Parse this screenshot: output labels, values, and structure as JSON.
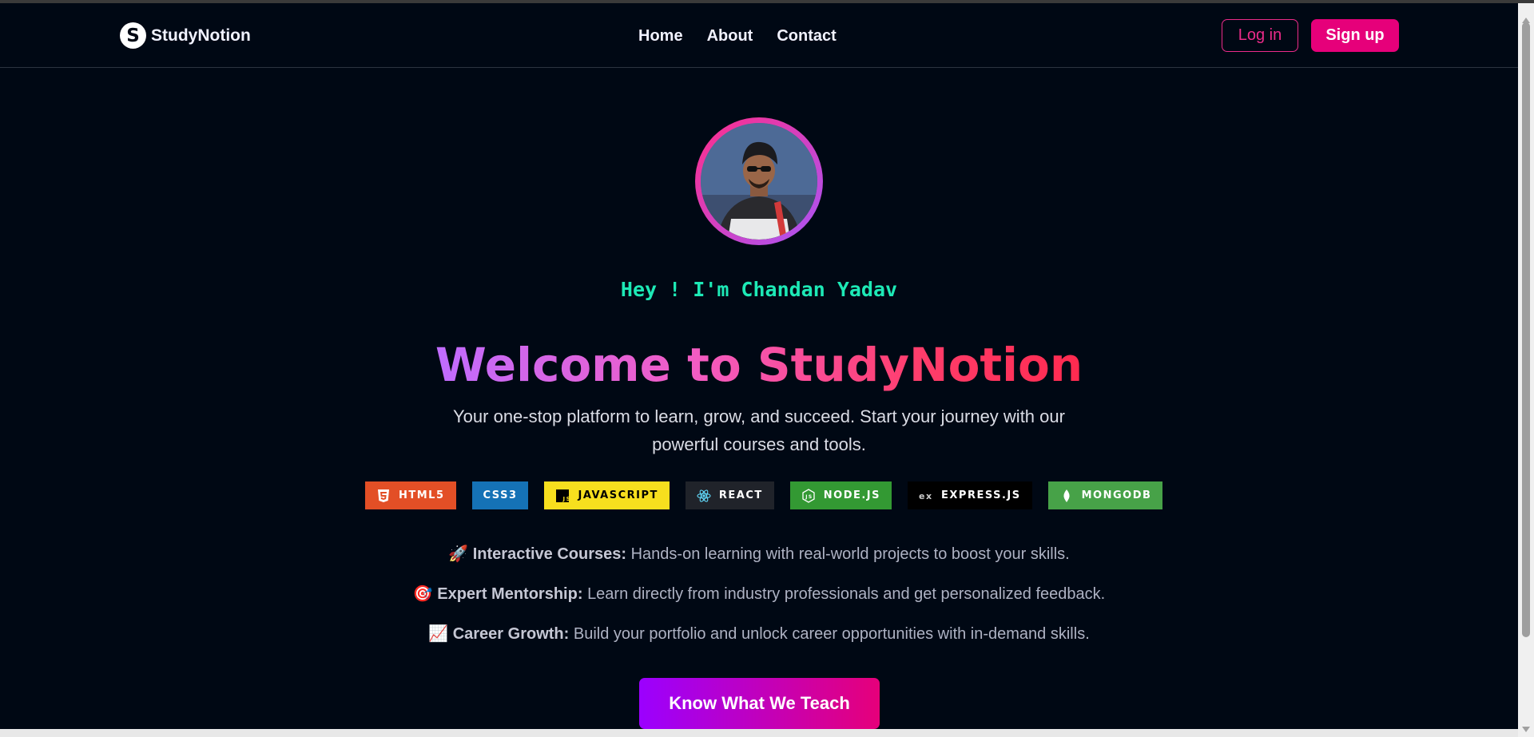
{
  "brand": {
    "logo_letter": "S",
    "name": "StudyNotion"
  },
  "nav": {
    "items": [
      "Home",
      "About",
      "Contact"
    ]
  },
  "auth": {
    "login_label": "Log in",
    "signup_label": "Sign up"
  },
  "hero": {
    "avatar": "profile-photo",
    "greeting": "Hey ! I'm Chandan Yadav",
    "headline": "Welcome to StudyNotion",
    "subtitle": "Your one-stop platform to learn, grow, and succeed. Start your journey with our powerful courses and tools."
  },
  "badges": [
    {
      "label": "HTML5",
      "color": "#e34f26",
      "icon": "html5-icon"
    },
    {
      "label": "CSS3",
      "color": "#1572b6",
      "icon": ""
    },
    {
      "label": "JAVASCRIPT",
      "color": "#f7df1e",
      "icon": "javascript-icon"
    },
    {
      "label": "REACT",
      "color": "#20232a",
      "icon": "react-icon"
    },
    {
      "label": "NODE.JS",
      "color": "#339933",
      "icon": "nodejs-icon"
    },
    {
      "label": "EXPRESS.JS",
      "color": "#000000",
      "icon": "express-icon"
    },
    {
      "label": "MONGODB",
      "color": "#47a248",
      "icon": "mongodb-icon"
    }
  ],
  "features": [
    {
      "emoji": "🚀",
      "title": "Interactive Courses:",
      "text": "Hands-on learning with real-world projects to boost your skills."
    },
    {
      "emoji": "🎯",
      "title": "Expert Mentorship:",
      "text": "Learn directly from industry professionals and get personalized feedback."
    },
    {
      "emoji": "📈",
      "title": "Career Growth:",
      "text": "Build your portfolio and unlock career opportunities with in-demand skills."
    }
  ],
  "cta": {
    "label": "Know What We Teach"
  },
  "colors": {
    "background": "#000814",
    "accent": "#e6007a",
    "greeting": "#1de9b6"
  }
}
